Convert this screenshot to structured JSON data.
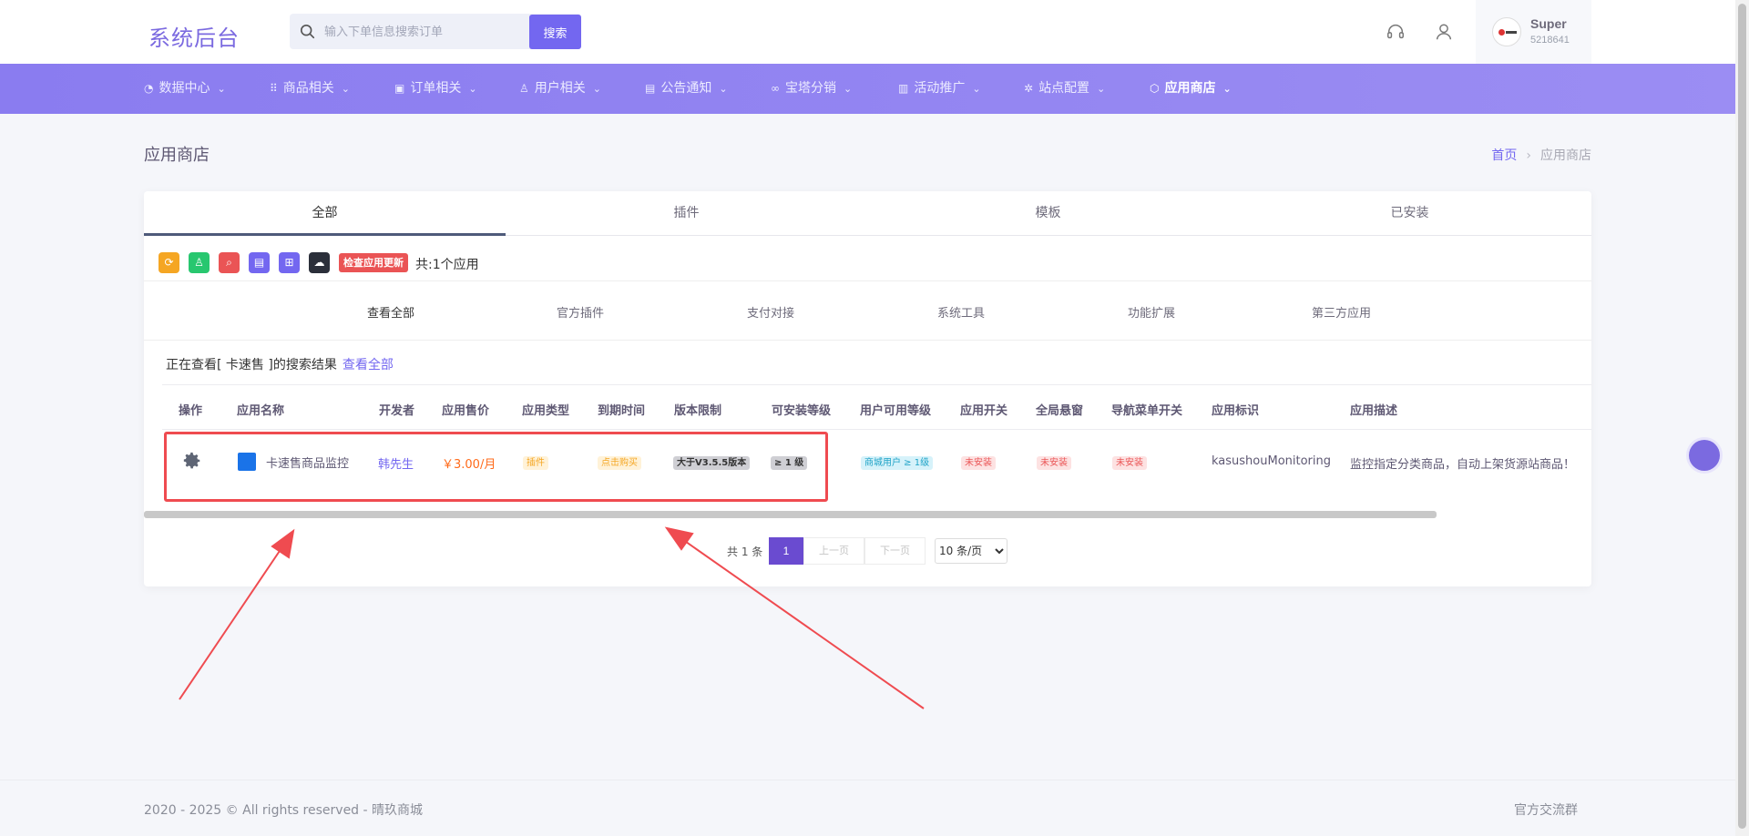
{
  "header": {
    "brand": "系统后台",
    "search_placeholder": "输入下单信息搜索订单",
    "search_button": "搜索",
    "user_name": "Super",
    "user_id": "5218641"
  },
  "nav": {
    "items": [
      {
        "label": "数据中心",
        "icon": "dashboard-icon"
      },
      {
        "label": "商品相关",
        "icon": "grid-icon"
      },
      {
        "label": "订单相关",
        "icon": "square-icon"
      },
      {
        "label": "用户相关",
        "icon": "user-icon"
      },
      {
        "label": "公告通知",
        "icon": "book-icon"
      },
      {
        "label": "宝塔分销",
        "icon": "link-icon"
      },
      {
        "label": "活动推广",
        "icon": "gift-icon"
      },
      {
        "label": "站点配置",
        "icon": "gear-icon"
      },
      {
        "label": "应用商店",
        "icon": "box-icon",
        "active": true
      }
    ]
  },
  "page": {
    "title": "应用商店",
    "breadcrumb_home": "首页",
    "breadcrumb_sep": "›",
    "breadcrumb_current": "应用商店"
  },
  "tabs": [
    "全部",
    "插件",
    "模板",
    "已安装"
  ],
  "toolbar": {
    "update_button": "检查应用更新",
    "count_text": "共:1个应用",
    "colors": [
      "#f5a623",
      "#28c76f",
      "#ea5455",
      "#7367f0",
      "#7367f0",
      "#2b2f3a"
    ]
  },
  "categories": [
    "查看全部",
    "官方插件",
    "支付对接",
    "系统工具",
    "功能扩展",
    "第三方应用"
  ],
  "result": {
    "prefix": "正在查看[ 卡速售 ]的搜索结果",
    "link": "查看全部"
  },
  "table": {
    "columns": [
      "操作",
      "应用名称",
      "开发者",
      "应用售价",
      "应用类型",
      "到期时间",
      "版本限制",
      "可安装等级",
      "用户可用等级",
      "应用开关",
      "全局悬窗",
      "导航菜单开关",
      "应用标识",
      "应用描述"
    ],
    "rows": [
      {
        "name": "卡速售商品监控",
        "developer": "韩先生",
        "price": "￥3.00/月",
        "type": "插件",
        "expire": "点击购买",
        "version": "大于V3.5.5版本",
        "install_level": "≥ 1 级",
        "user_level": "商城用户 ≥ 1级",
        "app_switch": "未安装",
        "float_window": "未安装",
        "nav_switch": "未安装",
        "identifier": "kasushouMonitoring",
        "description": "监控指定分类商品，自动上架货源站商品！"
      }
    ]
  },
  "pagination": {
    "total": "共 1 条",
    "current": "1",
    "prev": "上一页",
    "next": "下一页",
    "page_size": "10 条/页"
  },
  "footer": {
    "copyright": "2020 - 2025 © All rights reserved - 晴玖商城",
    "link": "官方交流群"
  }
}
